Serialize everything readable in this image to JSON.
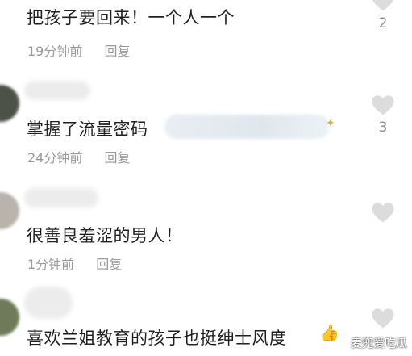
{
  "comments": [
    {
      "text": "把孩子要回来！一个人一个",
      "time": "19分钟前",
      "reply": "回复",
      "likes": "2"
    },
    {
      "text": "掌握了流量密码",
      "time": "24分钟前",
      "reply": "回复",
      "likes": "3"
    },
    {
      "text": "很善良羞涩的男人！",
      "time": "1分钟前",
      "reply": "回复",
      "likes": ""
    },
    {
      "text": "喜欢兰姐教育的孩子也挺绅士风度",
      "time": "",
      "reply": "",
      "likes": ""
    }
  ],
  "icons": {
    "like": "heart-icon",
    "emoji": "thumbs-up-icon"
  },
  "colors": {
    "text": "#1f1f1f",
    "meta": "#9a9a9a",
    "heart": "#dcdcdc"
  },
  "watermark": "麦兜爱吃瓜"
}
